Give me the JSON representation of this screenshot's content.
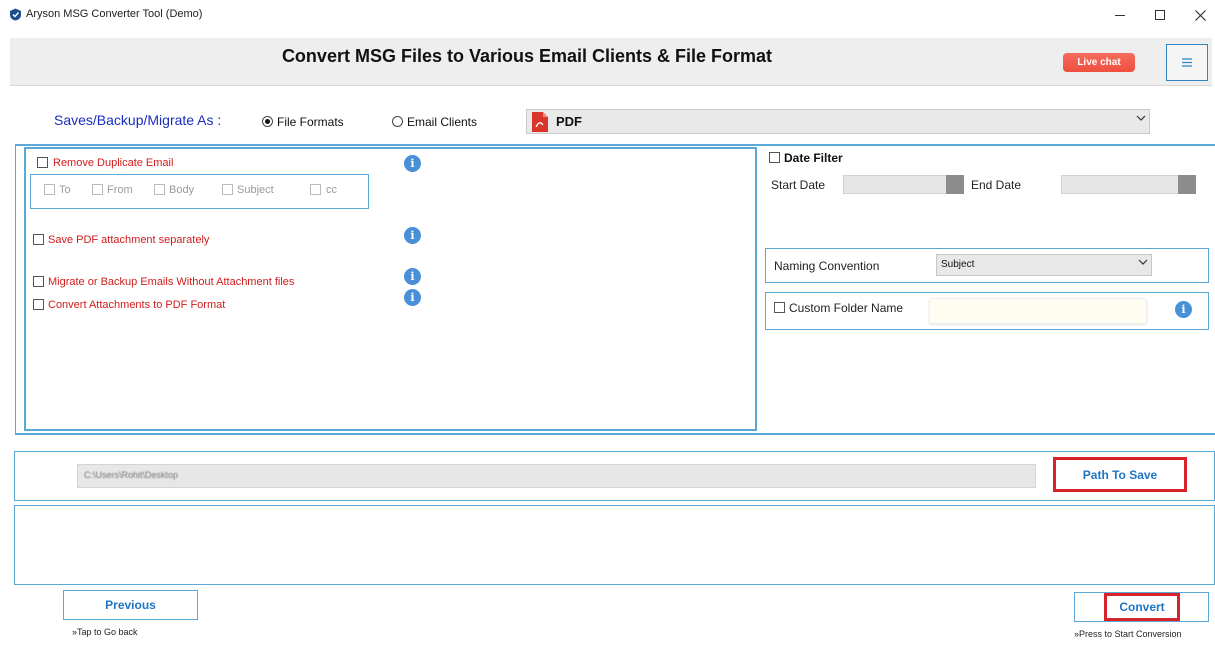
{
  "window": {
    "title": "Aryson MSG Converter Tool (Demo)",
    "minimize_icon": "minimize-icon",
    "maximize_icon": "maximize-icon",
    "close_icon": "close-icon"
  },
  "header": {
    "title": "Convert MSG Files to Various Email Clients & File Format",
    "live_chat": "Live chat",
    "menu_icon": "hamburger-icon"
  },
  "save_as": {
    "label": "Saves/Backup/Migrate As :",
    "options": [
      "File Formats",
      "Email Clients"
    ],
    "selected_option": "File Formats",
    "format_value": "PDF",
    "format_icon": "pdf-icon"
  },
  "options": {
    "remove_duplicate": "Remove Duplicate Email",
    "duplicate_fields": [
      "To",
      "From",
      "Body",
      "Subject",
      "cc"
    ],
    "save_pdf_attachment": "Save PDF attachment separately",
    "migrate_without_attachment": "Migrate or Backup Emails Without Attachment files",
    "convert_attachments": "Convert Attachments to PDF Format"
  },
  "date_filter": {
    "label": "Date Filter",
    "start_label": "Start Date",
    "end_label": "End Date"
  },
  "naming": {
    "label": "Naming Convention",
    "value": "Subject"
  },
  "custom_folder": {
    "label": "Custom Folder Name",
    "value": ""
  },
  "path": {
    "value": "C:\\Users\\Rohit\\Desktop",
    "button": "Path To Save"
  },
  "footer": {
    "previous": "Previous",
    "previous_hint": "»Tap to Go back",
    "convert": "Convert",
    "convert_hint": "»Press to Start Conversion"
  },
  "colors": {
    "accent_blue": "#5aa7d8",
    "label_blue": "#1a2dbf",
    "option_red": "#d11c1c",
    "highlight_red": "#d8232a",
    "live_chat": "#ef4f3f"
  }
}
